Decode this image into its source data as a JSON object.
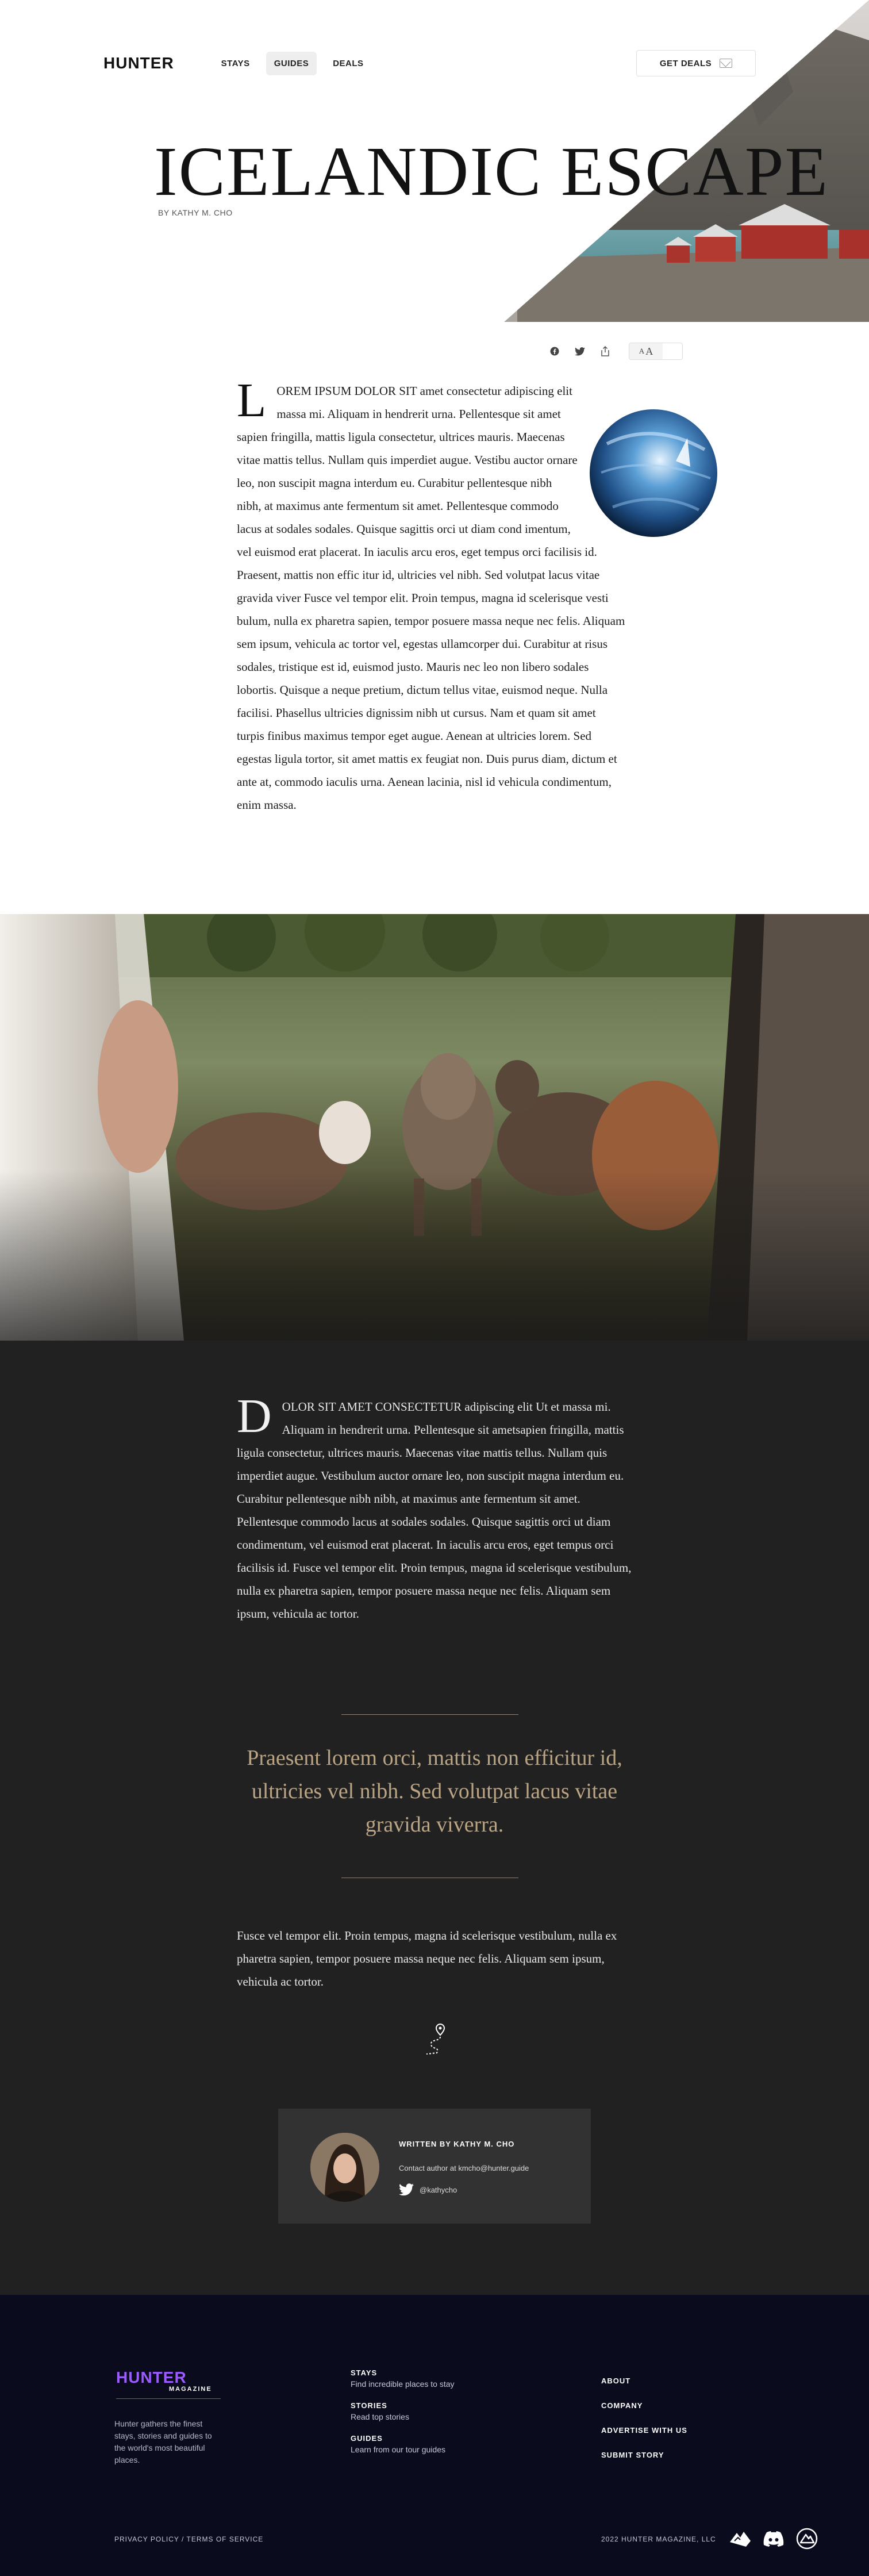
{
  "brand": {
    "logo": "HUNTER"
  },
  "nav": {
    "items": [
      {
        "label": "STAYS"
      },
      {
        "label": "GUIDES"
      },
      {
        "label": "DEALS"
      }
    ]
  },
  "header": {
    "deals_button": "GET DEALS"
  },
  "hero": {
    "title": "ICELANDIC ESCAPE",
    "byline": "BY KATHY M. CHO"
  },
  "toolbar": {
    "font_small": "A",
    "font_large": "A"
  },
  "article1": {
    "dropcap": "L",
    "lead": "orem ipsum dolor sit",
    "text": " amet consectetur adipiscing elit massa mi. Aliquam in hendrerit urna. Pellentesque sit amet sapien fringilla, mattis ligula consectetur, ultrices mauris. Maecenas vitae mattis tellus. Nullam quis imperdiet augue. Vestibu auctor ornare leo, non suscipit magna interdum eu. Curabitur pellentesque nibh nibh, at maximus ante fermentum sit amet. Pellentesque commodo lacus at sodales sodales. Quisque sagittis orci ut diam cond imentum, vel euismod erat placerat. In iaculis arcu eros, eget tempus orci facilisis id. Praesent, mattis non effic itur id, ultricies vel nibh. Sed volutpat lacus vitae gravida viver Fusce vel tempor elit. Proin tempus, magna id scelerisque vesti bulum, nulla ex pharetra sapien, tempor posuere massa neque nec felis. Aliquam sem ipsum, vehicula ac tortor vel, egestas ullamcorper dui. Curabitur at risus sodales, tristique est id, euismod justo. Mauris nec leo non libero sodales lobortis. Quisque a neque pretium, dictum tellus vitae, euismod neque. Nulla facilisi. Phasellus ultricies dignissim nibh ut cursus. Nam et quam sit amet turpis finibus maximus tempor eget augue. Aenean at ultricies lorem. Sed egestas ligula tortor, sit amet mattis ex feugiat non. Duis purus diam, dictum et ante at, commodo iaculis urna. Aenean lacinia, nisl id vehicula condimentum, enim massa."
  },
  "article2": {
    "dropcap": "D",
    "lead": "olor sit amet consectetur",
    "text": " adipiscing elit Ut et massa mi. Aliquam in hendrerit urna. Pellentesque sit ametsapien fringilla, mattis ligula consectetur, ultrices mauris. Maecenas vitae mattis tellus. Nullam quis imperdiet augue. Vestibulum auctor ornare leo, non suscipit magna interdum eu. Curabitur pellentesque nibh nibh, at maximus ante fermentum sit amet. Pellentesque commodo lacus at sodales sodales. Quisque sagittis orci ut diam condimentum, vel euismod erat placerat. In iaculis arcu eros, eget tempus orci facilisis id. Fusce vel tempor elit. Proin tempus, magna id scelerisque vestibulum, nulla ex pharetra sapien, tempor posuere massa neque nec felis. Aliquam sem ipsum, vehicula ac tortor.",
    "quote": "Praesent lorem orci, mattis non efficitur id, ultricies vel nibh. Sed volutpat lacus vitae gravida viverra.",
    "closing": "Fusce vel tempor elit. Proin tempus, magna id scelerisque vestibulum, nulla ex pharetra sapien, tempor posuere massa neque nec felis. Aliquam sem ipsum, vehicula ac tortor."
  },
  "author": {
    "name": "WRITTEN BY KATHY M. CHO",
    "contact": "Contact author at kmcho@hunter.guide",
    "twitter": "@kathycho"
  },
  "footer": {
    "logo_name": "HUNTER",
    "logo_sub": "MAGAZINE",
    "description": "Hunter gathers the finest stays, stories and guides to the world's most beautiful places.",
    "columns": [
      {
        "heading": "STAYS",
        "desc": "Find incredible places to stay"
      },
      {
        "heading": "STORIES",
        "desc": "Read top stories"
      },
      {
        "heading": "GUIDES",
        "desc": "Learn from our tour guides"
      }
    ],
    "links": [
      "ABOUT",
      "COMPANY",
      "ADVERTISE WITH US",
      "SUBMIT STORY"
    ],
    "legal": "PRIVACY POLICY / TERMS OF SERVICE",
    "copyright": "2022 HUNTER MAGAZINE, LLC"
  },
  "colors": {
    "accent_purple": "#9b5bff",
    "quote_gold": "#b9a484",
    "dark_bg": "#222121",
    "footer_bg": "#0a0b1c"
  },
  "icons": [
    "facebook-icon",
    "twitter-icon",
    "share-icon",
    "moon-icon",
    "mail-icon",
    "route-pin-icon",
    "discord-icon",
    "plane-icon",
    "mountain-logo-icon"
  ]
}
